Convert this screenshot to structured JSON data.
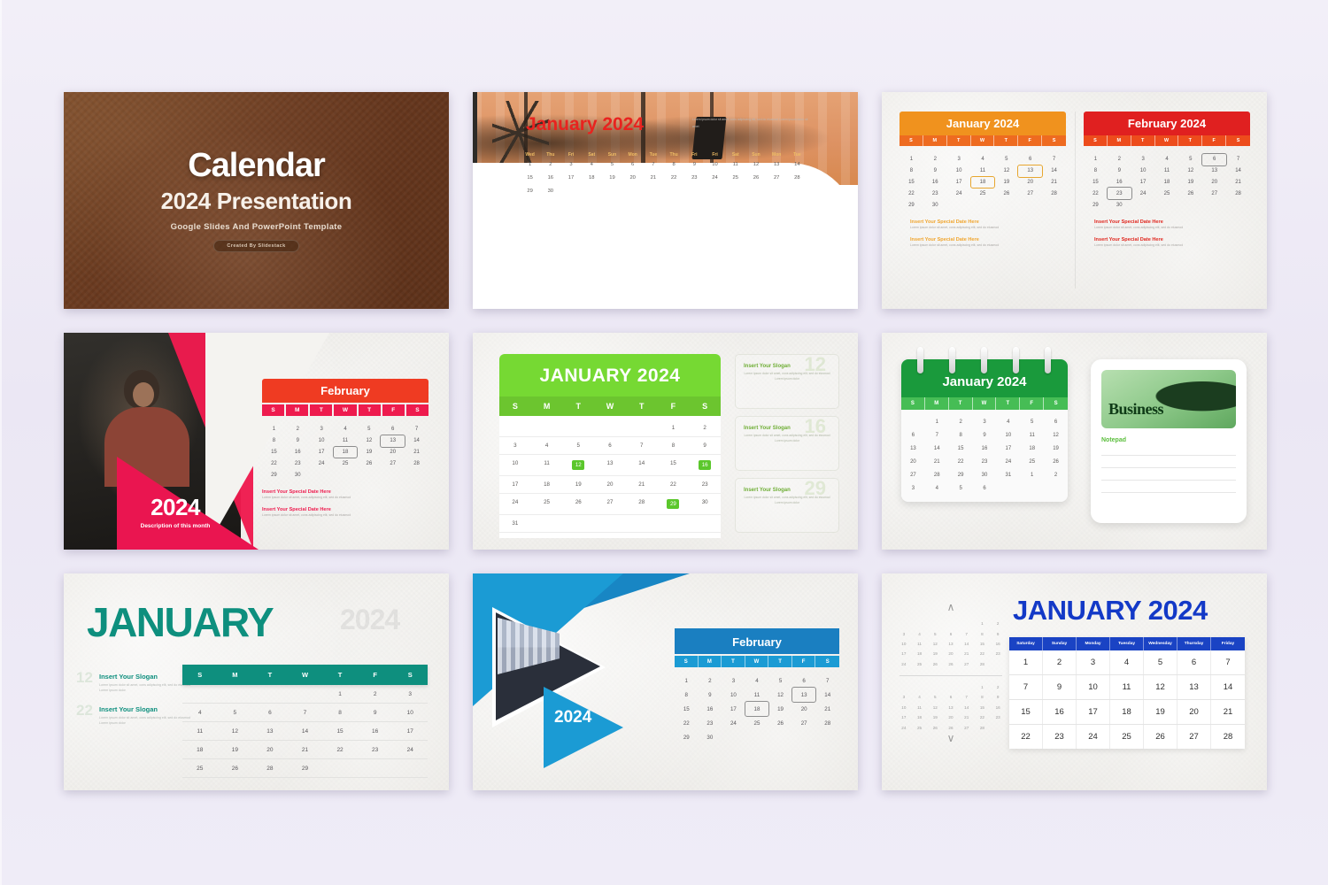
{
  "page": {
    "background": "#eeeaf6"
  },
  "slide1": {
    "title": "Calendar",
    "subtitle": "2024 Presentation",
    "tagline": "Google Slides And PowerPoint Template",
    "badge": "Created By Slidestack",
    "bg_color": "#6b3c20"
  },
  "slide2": {
    "heading": "January 2024",
    "lorem": "Lorem ipsum dolor sit amet, cons adipiscing elit, sed do eiusmod Lorem ipsum dolor sit amet",
    "accent": "#e8231f",
    "dow_color": "#efbd64",
    "dow": [
      "Wed",
      "Thu",
      "Fri",
      "Sat",
      "Sun",
      "Mon",
      "Tue",
      "Thu",
      "Fri",
      "Fri",
      "Sat",
      "Sun",
      "Mon",
      "Tue"
    ],
    "days": [
      "1",
      "2",
      "3",
      "4",
      "5",
      "6",
      "7",
      "8",
      "9",
      "10",
      "11",
      "12",
      "13",
      "14",
      "15",
      "16",
      "17",
      "18",
      "19",
      "20",
      "21",
      "22",
      "23",
      "24",
      "25",
      "26",
      "27",
      "28",
      "29",
      "30",
      "",
      "",
      "",
      "",
      "",
      "",
      "",
      "",
      "",
      "",
      "",
      "",
      ""
    ]
  },
  "slide3": {
    "january": {
      "title": "January 2024",
      "header_color": "#f0921e",
      "dow_color": "#ee6b20",
      "dow": [
        "S",
        "M",
        "T",
        "W",
        "T",
        "F",
        "S"
      ],
      "days": [
        "1",
        "2",
        "3",
        "4",
        "5",
        "6",
        "7",
        "8",
        "9",
        "10",
        "11",
        "12",
        "13",
        "14",
        "15",
        "16",
        "17",
        "18",
        "19",
        "20",
        "21",
        "22",
        "23",
        "24",
        "25",
        "26",
        "27",
        "28",
        "29",
        "30",
        "",
        "",
        "",
        "",
        ""
      ],
      "marked": [
        "13",
        "18"
      ],
      "notes": [
        {
          "title": "Insert Your Special Date Here",
          "desc": "Lorem ipsum dolor sit amet, cons adipiscing elit, sed do eiusmod"
        },
        {
          "title": "Insert Your Special Date Here",
          "desc": "Lorem ipsum dolor sit amet, cons adipiscing elit, sed do eiusmod"
        }
      ],
      "note_color": "#f0a52e"
    },
    "february": {
      "title": "February 2024",
      "header_color": "#e02020",
      "dow_color": "#ed4c1c",
      "dow": [
        "S",
        "M",
        "T",
        "W",
        "T",
        "F",
        "S"
      ],
      "days": [
        "1",
        "2",
        "3",
        "4",
        "5",
        "6",
        "7",
        "8",
        "9",
        "10",
        "11",
        "12",
        "13",
        "14",
        "15",
        "16",
        "17",
        "18",
        "19",
        "20",
        "21",
        "22",
        "23",
        "24",
        "25",
        "26",
        "27",
        "28",
        "29",
        "30",
        "",
        "",
        "",
        "",
        ""
      ],
      "marked": [
        "6",
        "23"
      ],
      "notes": [
        {
          "title": "Insert Your Special Date Here",
          "desc": "Lorem ipsum dolor sit amet, cons adipiscing elit, sed do eiusmod"
        },
        {
          "title": "Insert Your Special Date Here",
          "desc": "Lorem ipsum dolor sit amet, cons adipiscing elit, sed do eiusmod"
        }
      ],
      "note_color": "#e0261e"
    }
  },
  "slide4": {
    "month": "February",
    "year": "2024",
    "description": "Description of this month",
    "accent": "#ee1b4e",
    "header_color": "#ef3b22",
    "dow": [
      "S",
      "M",
      "T",
      "W",
      "T",
      "F",
      "S"
    ],
    "days": [
      "1",
      "2",
      "3",
      "4",
      "5",
      "6",
      "7",
      "8",
      "9",
      "10",
      "11",
      "12",
      "13",
      "14",
      "15",
      "16",
      "17",
      "18",
      "19",
      "20",
      "21",
      "22",
      "23",
      "24",
      "25",
      "26",
      "27",
      "28",
      "29",
      "30",
      "",
      "",
      "",
      "",
      ""
    ],
    "marked": [
      "13",
      "18"
    ],
    "notes": [
      {
        "title": "Insert Your Special Date Here",
        "desc": "Lorem ipsum dolor sit amet, cons adipiscing elit, sed do eiusmod"
      },
      {
        "title": "Insert Your Special Date Here",
        "desc": "Lorem ipsum dolor sit amet, cons adipiscing elit, sed do eiusmod"
      }
    ]
  },
  "slide5": {
    "title": "JANUARY 2024",
    "header_color": "#76d933",
    "dow_color": "#6cc52f",
    "highlight_color": "#5bc72c",
    "dow": [
      "S",
      "M",
      "T",
      "W",
      "T",
      "F",
      "S"
    ],
    "days": [
      "",
      "",
      "",
      "",
      "",
      "1",
      "2",
      "3",
      "4",
      "5",
      "6",
      "7",
      "8",
      "9",
      "10",
      "11",
      "12",
      "13",
      "14",
      "15",
      "16",
      "17",
      "18",
      "19",
      "20",
      "21",
      "22",
      "23",
      "24",
      "25",
      "26",
      "27",
      "28",
      "29",
      "30",
      "31",
      "",
      "",
      "",
      "",
      "",
      ""
    ],
    "highlighted": [
      "12",
      "16",
      "29"
    ],
    "slogans": [
      {
        "number": "12",
        "title": "Insert Your Slogan",
        "desc": "Lorem ipsum dolor sit amet, cons adipiscing elit, sed do eiusmod Lorem ipsum dolor"
      },
      {
        "number": "16",
        "title": "Insert Your Slogan",
        "desc": "Lorem ipsum dolor sit amet, cons adipiscing elit, sed do eiusmod Lorem ipsum dolor"
      },
      {
        "number": "29",
        "title": "Insert Your Slogan",
        "desc": "Lorem ipsum dolor sit amet, cons adipiscing elit, sed do eiusmod Lorem ipsum dolor"
      }
    ]
  },
  "slide6": {
    "title": "January 2024",
    "header_color": "#1a9a3c",
    "dow_color": "#46bd55",
    "dow": [
      "S",
      "M",
      "T",
      "W",
      "T",
      "F",
      "S"
    ],
    "days": [
      "",
      "1",
      "2",
      "3",
      "4",
      "5",
      "6",
      "6",
      "7",
      "8",
      "9",
      "10",
      "11",
      "12",
      "13",
      "14",
      "15",
      "16",
      "17",
      "18",
      "19",
      "20",
      "21",
      "22",
      "23",
      "24",
      "25",
      "26",
      "27",
      "28",
      "29",
      "30",
      "31",
      "1",
      "2",
      "3",
      "4",
      "5",
      "6",
      "",
      "",
      ""
    ],
    "notepad_label": "Notepad",
    "photo_word": "Business",
    "ring_count": 5
  },
  "slide7": {
    "title": "JANUARY",
    "year": "2024",
    "accent": "#0e8f7e",
    "dow": [
      "S",
      "M",
      "T",
      "W",
      "T",
      "F",
      "S"
    ],
    "days": [
      "",
      "",
      "",
      "",
      "1",
      "2",
      "3",
      "4",
      "5",
      "6",
      "7",
      "8",
      "9",
      "10",
      "11",
      "12",
      "13",
      "14",
      "15",
      "16",
      "17",
      "18",
      "19",
      "20",
      "21",
      "22",
      "23",
      "24",
      "25",
      "26",
      "28",
      "29",
      "",
      "",
      ""
    ],
    "slogans": [
      {
        "number": "12",
        "title": "Insert Your Slogan",
        "desc": "Lorem ipsum dolor sit amet, cons adipiscing elit, sed do eiusmod Lorem ipsum dolor"
      },
      {
        "number": "22",
        "title": "Insert Your Slogan",
        "desc": "Lorem ipsum dolor sit amet, cons adipiscing elit, sed do eiusmod Lorem ipsum dolor"
      }
    ]
  },
  "slide8": {
    "month": "February",
    "year": "2024",
    "header_color": "#1a7fc1",
    "dow_color": "#1b9bd4",
    "dow": [
      "S",
      "M",
      "T",
      "W",
      "T",
      "F",
      "S"
    ],
    "days": [
      "1",
      "2",
      "3",
      "4",
      "5",
      "6",
      "7",
      "8",
      "9",
      "10",
      "11",
      "12",
      "13",
      "14",
      "15",
      "16",
      "17",
      "18",
      "19",
      "20",
      "21",
      "22",
      "23",
      "24",
      "25",
      "26",
      "27",
      "28",
      "29",
      "30",
      "",
      "",
      "",
      "",
      ""
    ],
    "marked": [
      "13",
      "18"
    ]
  },
  "slide9": {
    "title": "JANUARY 2024",
    "accent": "#1339c7",
    "header_color": "#1a43c4",
    "columns": [
      "Saturday",
      "Sunday",
      "Monday",
      "Tuesday",
      "Wednesday",
      "Thursday",
      "Friday"
    ],
    "rows": [
      [
        "1",
        "2",
        "3",
        "4",
        "5",
        "6",
        "7"
      ],
      [
        "7",
        "9",
        "10",
        "11",
        "12",
        "13",
        "14"
      ],
      [
        "15",
        "16",
        "17",
        "18",
        "19",
        "20",
        "21"
      ],
      [
        "22",
        "23",
        "24",
        "25",
        "26",
        "27",
        "28"
      ]
    ],
    "mini_up_icon": "∧",
    "mini_down_icon": "∨",
    "mini_top_days": [
      "",
      "",
      "",
      "",
      "",
      "1",
      "2",
      "3",
      "4",
      "5",
      "6",
      "7",
      "8",
      "9",
      "10",
      "11",
      "12",
      "13",
      "14",
      "15",
      "16",
      "17",
      "18",
      "19",
      "20",
      "21",
      "22",
      "23",
      "24",
      "25",
      "26",
      "26",
      "27",
      "28",
      ""
    ],
    "mini_bottom_days": [
      "",
      "",
      "",
      "",
      "",
      "1",
      "2",
      "3",
      "4",
      "5",
      "6",
      "7",
      "8",
      "9",
      "10",
      "11",
      "12",
      "13",
      "14",
      "15",
      "16",
      "17",
      "18",
      "19",
      "20",
      "21",
      "22",
      "23",
      "24",
      "25",
      "26",
      "26",
      "27",
      "28",
      ""
    ]
  }
}
